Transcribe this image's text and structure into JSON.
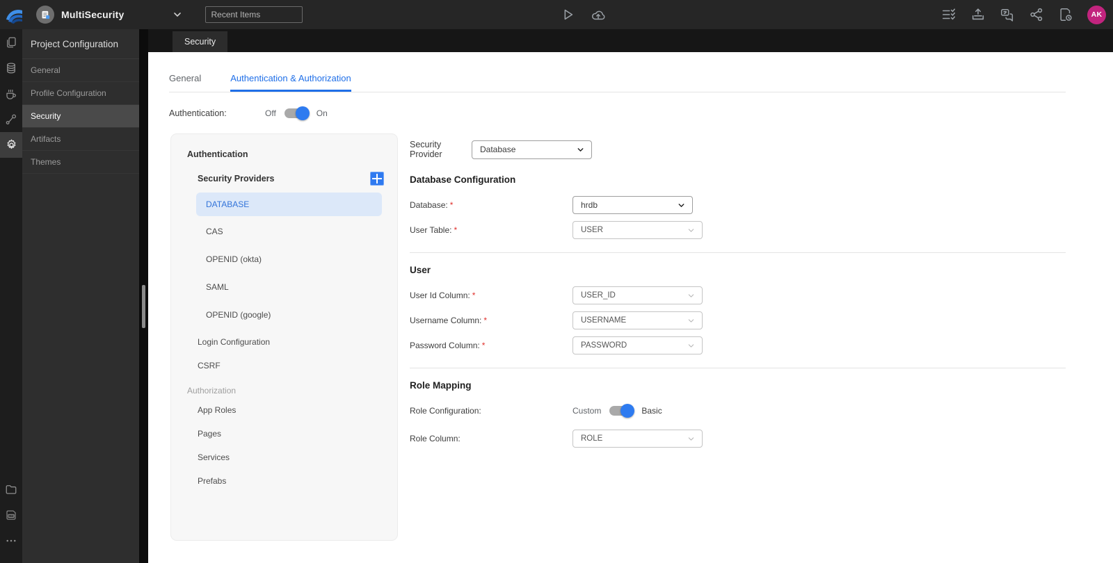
{
  "topbar": {
    "project_name": "MultiSecurity",
    "recent_items_placeholder": "Recent Items",
    "avatar_initials": "AK",
    "icons": [
      "wavemaker-logo",
      "project",
      "chevron-down",
      "preview-play",
      "deploy-cloud-upload",
      "release-checklist",
      "export-tray",
      "chat-translate",
      "share-branch",
      "file-history",
      "avatar"
    ]
  },
  "sidebar": {
    "rail_icons": [
      "pages",
      "database",
      "java-services",
      "apis",
      "settings-gear",
      "file-explorer",
      "logs",
      "more"
    ],
    "panel_title": "Project Configuration",
    "items": [
      {
        "label": "General",
        "active": false
      },
      {
        "label": "Profile Configuration",
        "active": false
      },
      {
        "label": "Security",
        "active": true
      },
      {
        "label": "Artifacts",
        "active": false
      },
      {
        "label": "Themes",
        "active": false
      }
    ]
  },
  "main": {
    "header_tab": "Security",
    "tabs": [
      {
        "label": "General",
        "active": false
      },
      {
        "label": "Authentication & Authorization",
        "active": true
      }
    ],
    "auth_toggle": {
      "label": "Authentication:",
      "off": "Off",
      "on": "On",
      "state": "on"
    },
    "nav": {
      "section_auth": "Authentication",
      "providers_label": "Security Providers",
      "providers": [
        {
          "label": "DATABASE",
          "active": true
        },
        {
          "label": "CAS",
          "active": false
        },
        {
          "label": "OPENID (okta)",
          "active": false
        },
        {
          "label": "SAML",
          "active": false
        },
        {
          "label": "OPENID (google)",
          "active": false
        }
      ],
      "auth_items": [
        "Login Configuration",
        "CSRF"
      ],
      "section_authz": "Authorization",
      "authz_items": [
        "App Roles",
        "Pages",
        "Services",
        "Prefabs"
      ]
    },
    "form": {
      "security_provider": {
        "label": "Security Provider",
        "value": "Database"
      },
      "db_heading": "Database Configuration",
      "db_fields": [
        {
          "label": "Database:",
          "required": "*",
          "value": "hrdb"
        },
        {
          "label": "User Table:",
          "required": "*",
          "value": "USER"
        }
      ],
      "user_heading": "User",
      "user_fields": [
        {
          "label": "User Id Column:",
          "required": "*",
          "value": "USER_ID"
        },
        {
          "label": "Username Column:",
          "required": "*",
          "value": "USERNAME"
        },
        {
          "label": "Password Column:",
          "required": "*",
          "value": "PASSWORD"
        }
      ],
      "role_heading": "Role Mapping",
      "role_config": {
        "label": "Role Configuration:",
        "left": "Custom",
        "right": "Basic",
        "state": "basic"
      },
      "role_column": {
        "label": "Role Column:",
        "value": "ROLE"
      }
    },
    "colors": {
      "accent_blue": "#1f6fe8",
      "toggle_knob": "#2e7bf0",
      "required_red": "#e0312d",
      "avatar_pink": "#c2247e"
    }
  }
}
